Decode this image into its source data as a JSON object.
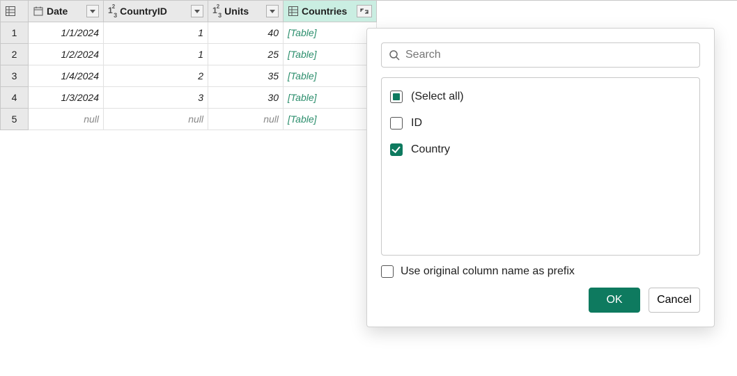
{
  "columns": {
    "date": {
      "label": "Date",
      "type": "date"
    },
    "countryId": {
      "label": "CountryID",
      "type": "number"
    },
    "units": {
      "label": "Units",
      "type": "number"
    },
    "countries": {
      "label": "Countries",
      "type": "table"
    }
  },
  "rows": [
    {
      "n": "1",
      "date": "1/1/2024",
      "countryId": "1",
      "units": "40",
      "countries": "[Table]"
    },
    {
      "n": "2",
      "date": "1/2/2024",
      "countryId": "1",
      "units": "25",
      "countries": "[Table]"
    },
    {
      "n": "3",
      "date": "1/4/2024",
      "countryId": "2",
      "units": "35",
      "countries": "[Table]"
    },
    {
      "n": "4",
      "date": "1/3/2024",
      "countryId": "3",
      "units": "30",
      "countries": "[Table]"
    },
    {
      "n": "5",
      "date": "null",
      "countryId": "null",
      "units": "null",
      "countries": "[Table]"
    }
  ],
  "popup": {
    "search_placeholder": "Search",
    "options": {
      "selectAll": {
        "label": "(Select all)",
        "state": "indeterminate"
      },
      "id": {
        "label": "ID",
        "state": "unchecked"
      },
      "country": {
        "label": "Country",
        "state": "checked"
      }
    },
    "prefix": {
      "label": "Use original column name as prefix",
      "state": "unchecked"
    },
    "ok_label": "OK",
    "cancel_label": "Cancel"
  }
}
